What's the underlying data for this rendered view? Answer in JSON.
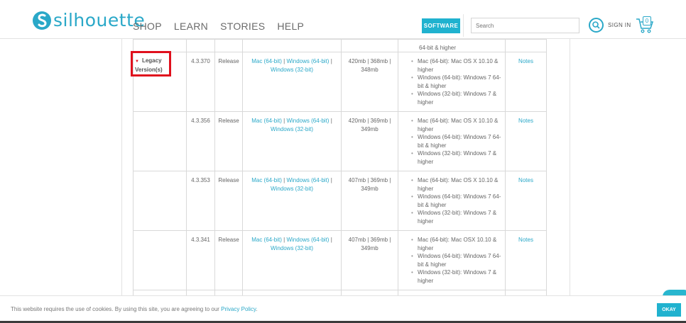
{
  "header": {
    "logo_text": "silhouette",
    "nav": [
      "SHOP",
      "LEARN",
      "STORIES",
      "HELP"
    ],
    "software_label": "SOFTWARE",
    "search_placeholder": "Search",
    "signin_label": "SIGN IN",
    "cart_count": "0"
  },
  "legacy": {
    "label_line1": "Legacy",
    "label_line2": "Version(s)"
  },
  "top_row": {
    "req_tail": "64-bit & higher"
  },
  "rows": [
    {
      "version": "4.3.370",
      "type": "Release",
      "mac_link": "Mac (64-bit)",
      "win64_link": "Windows (64-bit)",
      "win32_link": "Windows (32-bit)",
      "sizes": "420mb | 368mb | 348mb",
      "req": [
        "Mac (64-bit): Mac OS X 10.10 & higher",
        "Windows (64-bit): Windows 7 64-bit & higher",
        "Windows (32-bit): Windows 7 & higher"
      ],
      "notes": "Notes"
    },
    {
      "version": "4.3.356",
      "type": "Release",
      "mac_link": "Mac (64-bit)",
      "win64_link": "Windows (64-bit)",
      "win32_link": "Windows (32-bit)",
      "sizes": "420mb | 369mb | 349mb",
      "req": [
        "Mac (64-bit): Mac OS X 10.10 & higher",
        "Windows (64-bit): Windows 7 64-bit & higher",
        "Windows (32-bit): Windows 7 & higher"
      ],
      "notes": "Notes"
    },
    {
      "version": "4.3.353",
      "type": "Release",
      "mac_link": "Mac (64-bit)",
      "win64_link": "Windows (64-bit)",
      "win32_link": "Windows (32-bit)",
      "sizes": "407mb | 369mb | 349mb",
      "req": [
        "Mac (64-bit): Mac OS X 10.10 & higher",
        "Windows (64-bit): Windows 7 64-bit & higher",
        "Windows (32-bit): Windows 7 & higher"
      ],
      "notes": "Notes"
    },
    {
      "version": "4.3.341",
      "type": "Release",
      "mac_link": "Mac (64-bit)",
      "win64_link": "Windows (64-bit)",
      "win32_link": "Windows (32-bit)",
      "sizes": "407mb | 369mb | 349mb",
      "req": [
        "Mac (64-bit): Mac OSX 10.10 & higher",
        "Windows (64-bit): Windows 7 64-bit & higher",
        "Windows (32-bit): Windows 7 & higher"
      ],
      "notes": "Notes"
    }
  ],
  "cookie": {
    "text": "This website requires the use of cookies. By using this site, you are agreeing to our ",
    "link": "Privacy Policy",
    "suffix": ".",
    "okay_label": "OKAY"
  },
  "colors": {
    "brand": "#2aa8c8",
    "button": "#20b2cf",
    "highlight": "#e0101d"
  }
}
